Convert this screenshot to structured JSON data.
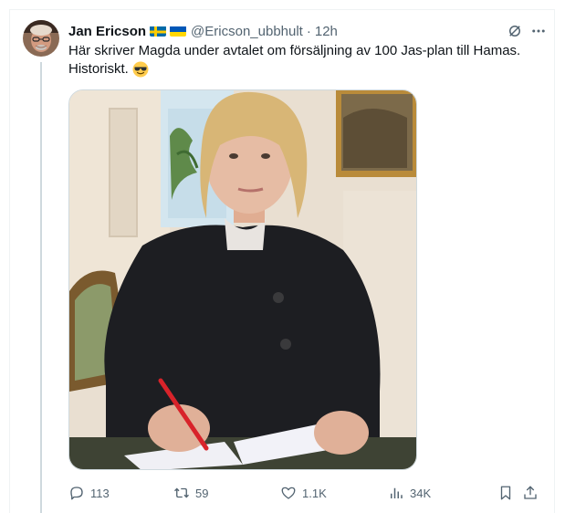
{
  "author": {
    "display_name": "Jan Ericson",
    "handle": "@Ericson_ubbhult",
    "separator": "·",
    "time": "12h"
  },
  "tweet": {
    "line1": "Här skriver Magda under avtalet om försäljning av 100 Jas-plan till Hamas.",
    "line2": "Historiskt."
  },
  "stats": {
    "replies": "113",
    "retweets": "59",
    "likes": "1.1K",
    "views": "34K"
  },
  "icons": {
    "flags": [
      "sweden-flag-icon",
      "ukraine-flag-icon"
    ],
    "emoji": "sunglasses-face-icon",
    "top_right": [
      "grok-icon",
      "more-icon"
    ],
    "actions": [
      "reply-icon",
      "retweet-icon",
      "like-icon",
      "views-icon",
      "bookmark-icon",
      "share-icon"
    ]
  },
  "colors": {
    "text_primary": "#0f1419",
    "text_secondary": "#536471",
    "thread_line": "#cfd9de"
  }
}
